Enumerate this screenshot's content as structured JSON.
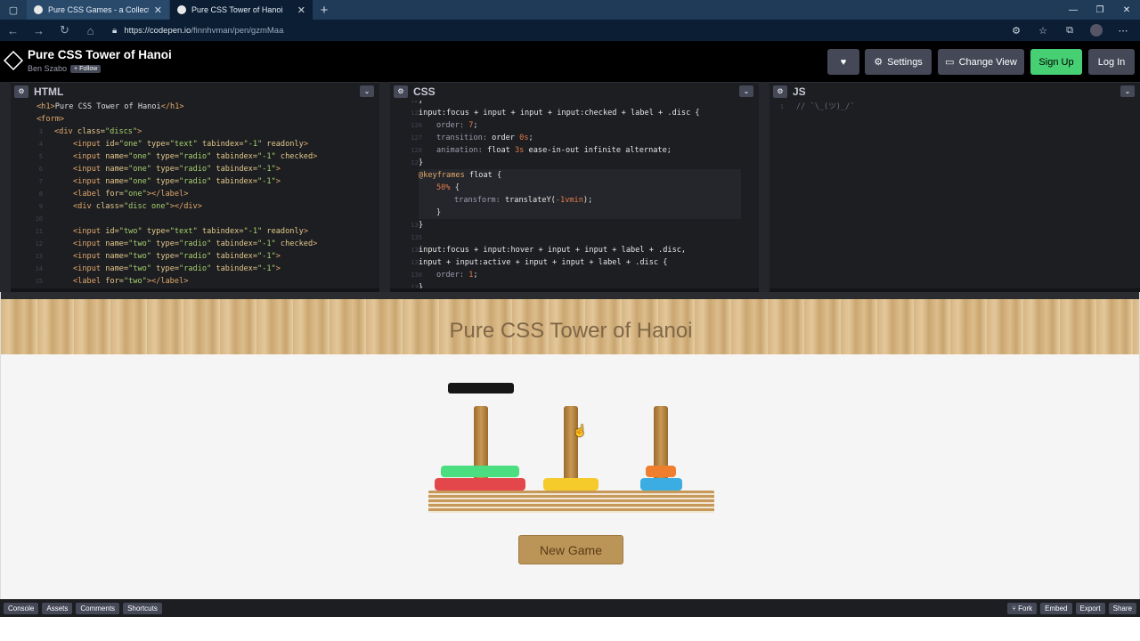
{
  "browser": {
    "tabs": [
      {
        "title": "Pure CSS Games - a Collection b",
        "active": false
      },
      {
        "title": "Pure CSS Tower of Hanoi",
        "active": true
      }
    ],
    "url_host": "https://codepen.io",
    "url_path": "/finnhvman/pen/gzmMaa",
    "icons": {
      "back": "←",
      "forward": "→",
      "reload": "↻",
      "home": "⌂",
      "lock": "🔒",
      "new_tab": "+",
      "close": "✕",
      "minimize": "—",
      "maximize": "❐",
      "window_close": "✕",
      "more": "⋯"
    }
  },
  "header": {
    "title": "Pure CSS Tower of Hanoi",
    "author": "Ben Szabo",
    "follow_label": "+ Follow",
    "heart_label": "♥",
    "settings_label": "Settings",
    "change_view_label": "Change View",
    "signup_label": "Sign Up",
    "login_label": "Log In"
  },
  "editors": {
    "html": {
      "title": "HTML"
    },
    "css": {
      "title": "CSS"
    },
    "js": {
      "title": "JS",
      "code": "// ¯\\_(ツ)_/¯"
    }
  },
  "preview": {
    "heading": "Pure CSS Tower of Hanoi",
    "new_game_label": "New Game",
    "colors": {
      "green": "#4ade80",
      "red": "#e3474b",
      "yellow": "#f4cb2b",
      "orange": "#ef7f2f",
      "blue": "#3bade2",
      "black": "#151515"
    }
  },
  "bottom": {
    "left": [
      "Console",
      "Assets",
      "Comments",
      "Shortcuts"
    ],
    "right": [
      "Fork",
      "Embed",
      "Export",
      "Share"
    ]
  }
}
